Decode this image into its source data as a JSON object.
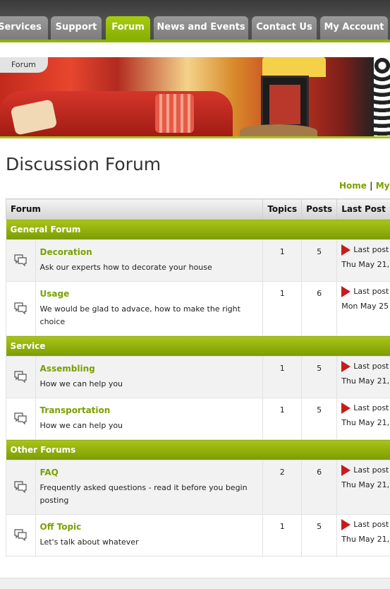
{
  "nav": {
    "tabs": [
      {
        "label": "Services"
      },
      {
        "label": "Support"
      },
      {
        "label": "Forum"
      },
      {
        "label": "News and Events"
      },
      {
        "label": "Contact Us"
      },
      {
        "label": "My Account"
      }
    ],
    "active_tab": "Forum"
  },
  "banner": {
    "tag": "Forum"
  },
  "page": {
    "title": "Discussion Forum",
    "links": {
      "home": "Home",
      "separator": "|",
      "my": "My"
    }
  },
  "table": {
    "headers": {
      "forum": "Forum",
      "topics": "Topics",
      "posts": "Posts",
      "last_post": "Last Post"
    },
    "sections": [
      {
        "name": "General Forum",
        "forums": [
          {
            "name": "Decoration",
            "desc": "Ask our experts how to decorate your house",
            "topics": "1",
            "posts": "5",
            "last": "Last post",
            "date": "Thu May 21,"
          },
          {
            "name": "Usage",
            "desc": "We would be glad to advace, how to make the right choice",
            "topics": "1",
            "posts": "6",
            "last": "Last post",
            "date": "Mon May 25"
          }
        ]
      },
      {
        "name": "Service",
        "forums": [
          {
            "name": "Assembling",
            "desc": "How we can help you",
            "topics": "1",
            "posts": "5",
            "last": "Last post",
            "date": "Thu May 21,"
          },
          {
            "name": "Transportation",
            "desc": "How we can help you",
            "topics": "1",
            "posts": "5",
            "last": "Last post",
            "date": "Thu May 21,"
          }
        ]
      },
      {
        "name": "Other Forums",
        "forums": [
          {
            "name": "FAQ",
            "desc": "Frequently asked questions - read it before you begin posting",
            "topics": "2",
            "posts": "6",
            "last": "Last post",
            "date": "Thu May 21,"
          },
          {
            "name": "Off Topic",
            "desc": "Let's talk about whatever",
            "topics": "1",
            "posts": "5",
            "last": "Last post",
            "date": "Thu May 21,"
          }
        ]
      }
    ]
  },
  "colors": {
    "accent": "#8db300",
    "link": "#7aa000",
    "arrow": "#c51c1c"
  }
}
